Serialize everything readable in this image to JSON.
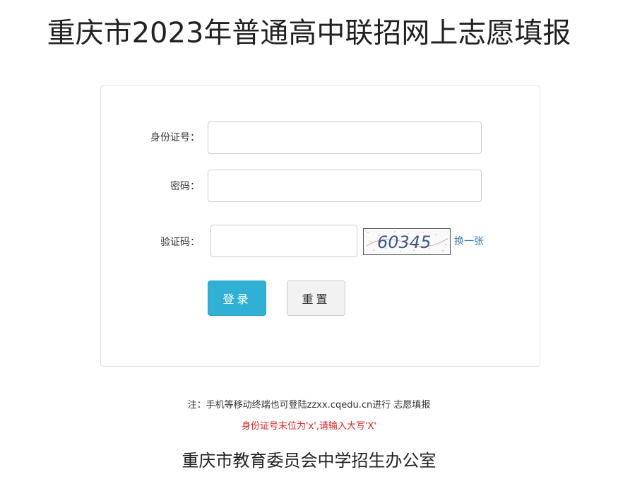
{
  "header": {
    "title": "重庆市2023年普通高中联招网上志愿填报"
  },
  "login_form": {
    "id_label": "身份证号：",
    "id_value": "",
    "password_label": "密码：",
    "password_value": "",
    "captcha_label": "验证码：",
    "captcha_value": "",
    "captcha_image_text": "60345",
    "refresh_captcha_label": "换一张",
    "login_button_label": "登录",
    "reset_button_label": "重置"
  },
  "footer": {
    "note": "注：手机等移动终端也可登陆zzxx.cqedu.cn进行 志愿填报",
    "warning": "身份证号末位为'x',请输入大写'X'",
    "organization": "重庆市教育委员会中学招生办公室"
  },
  "colors": {
    "login_button_bg": "#31b0d5",
    "link": "#337ab7",
    "warning": "#e02020"
  }
}
